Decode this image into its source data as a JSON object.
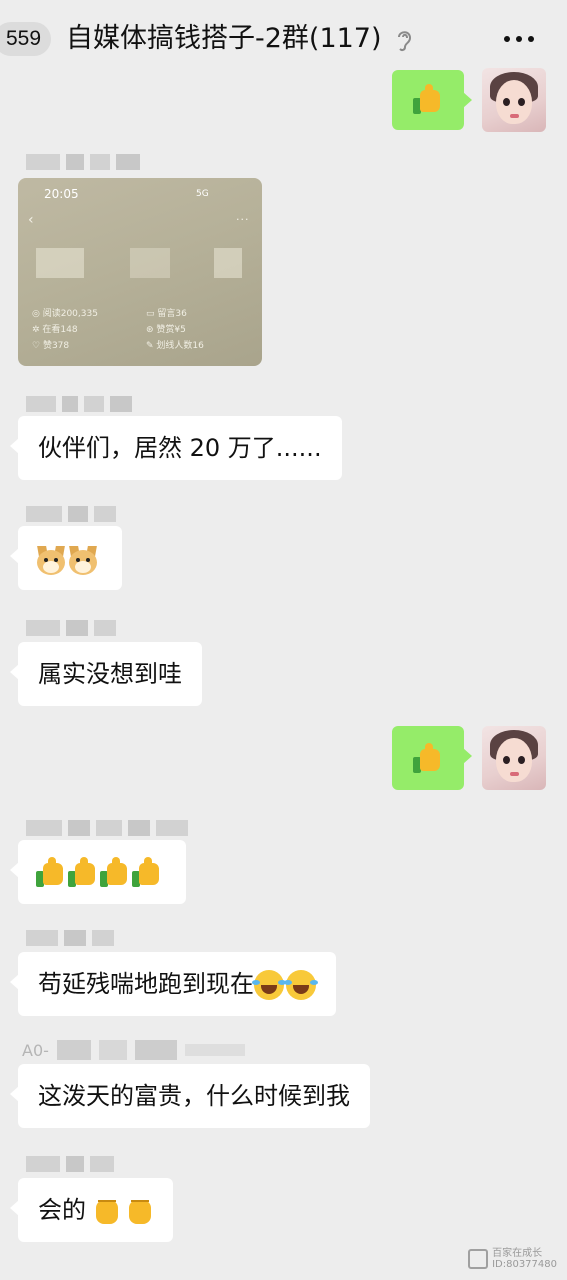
{
  "header": {
    "unread_count": "559",
    "title": "自媒体搞钱搭子-2群(117)",
    "icons": {
      "ear": "ear-icon",
      "more": "more-icon"
    }
  },
  "share_screenshot": {
    "time": "20:05",
    "network": "5G",
    "stats": {
      "reads": "阅读200,335",
      "comments": "留言36",
      "viewing": "在看148",
      "tips": "赞赏¥5",
      "likes": "赞378",
      "underline": "划线人数16"
    }
  },
  "messages": [
    {
      "from": "self",
      "content": "thumbs-up"
    },
    {
      "from": "other",
      "content": "image"
    },
    {
      "from": "other",
      "text": "伙伴们，居然 20 万了......"
    },
    {
      "from": "other",
      "content": "doge-doge"
    },
    {
      "from": "other",
      "text": "属实没想到哇"
    },
    {
      "from": "self",
      "content": "thumbs-up"
    },
    {
      "from": "other",
      "content": "thumbs-up x4"
    },
    {
      "from": "other",
      "text": "苟延残喘地跑到现在"
    },
    {
      "from": "other",
      "text": "这泼天的富贵，什么时候到我"
    },
    {
      "from": "other",
      "text": "会的"
    }
  ],
  "sender_partial_name": "A0-",
  "watermark": {
    "line1": "百家在成长",
    "line2": "ID:80377480"
  },
  "colors": {
    "background": "#ededed",
    "incoming_bubble": "#ffffff",
    "outgoing_bubble": "#95ec69"
  }
}
